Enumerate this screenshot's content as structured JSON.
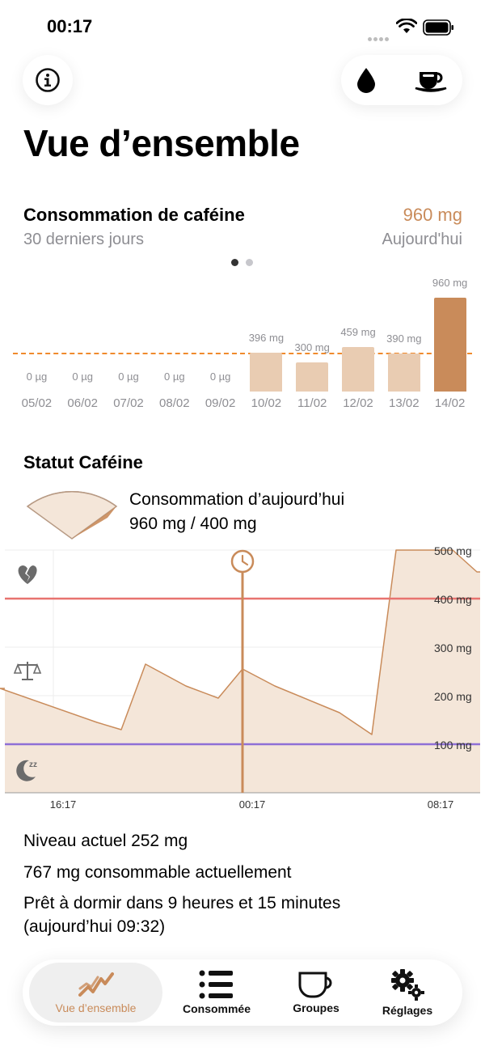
{
  "status_bar": {
    "time": "00:17"
  },
  "page_title": "Vue d’ensemble",
  "consumption": {
    "title": "Consommation de caféine",
    "subtitle": "30 derniers jours",
    "today_value": "960 mg",
    "today_label": "Aujourd'hui"
  },
  "chart_data": {
    "type": "bar",
    "categories": [
      "05/02",
      "06/02",
      "07/02",
      "08/02",
      "09/02",
      "10/02",
      "11/02",
      "12/02",
      "13/02",
      "14/02"
    ],
    "values": [
      0,
      0,
      0,
      0,
      0,
      396,
      300,
      459,
      390,
      960
    ],
    "value_labels": [
      "0 µg",
      "0 µg",
      "0 µg",
      "0 µg",
      "0 µg",
      "396 mg",
      "300 mg",
      "459 mg",
      "390 mg",
      "960 mg"
    ],
    "reference_line": 400,
    "ylim": [
      0,
      960
    ],
    "highlight_index": 9,
    "colors": {
      "bar": "#e9ccb2",
      "highlight": "#c98b5a",
      "reference": "#f08a2c"
    }
  },
  "status": {
    "title": "Statut Caféine",
    "today_label": "Consommation d’aujourd’hui",
    "today_value": "960 mg / 400 mg",
    "icons": [
      "broken-heart-icon",
      "scale-icon",
      "sleep-moon-icon",
      "clock-icon"
    ]
  },
  "level_chart": {
    "type": "area",
    "y_ticks": [
      "500 mg",
      "400 mg",
      "300 mg",
      "200 mg",
      "100 mg"
    ],
    "x_ticks": [
      "16:17",
      "00:17",
      "08:17"
    ],
    "ylim": [
      0,
      500
    ],
    "max_line": 400,
    "sleep_line": 100,
    "points": [
      [
        0,
        215
      ],
      [
        120,
        145
      ],
      [
        150,
        130
      ],
      [
        180,
        265
      ],
      [
        230,
        220
      ],
      [
        270,
        195
      ],
      [
        300,
        255
      ],
      [
        340,
        220
      ],
      [
        420,
        165
      ],
      [
        460,
        120
      ],
      [
        490,
        500
      ],
      [
        560,
        500
      ],
      [
        590,
        455
      ]
    ],
    "colors": {
      "fill": "#f4e6d9",
      "stroke": "#c98b5a",
      "max": "#e8736f",
      "sleep": "#8e6fd6",
      "now": "#c98b5a"
    }
  },
  "info": {
    "current_level": "Niveau actuel 252 mg",
    "consumable": "767 mg consommable actuellement",
    "sleep_ready": "Prêt à dormir dans 9 heures et 15 minutes",
    "sleep_time": "(aujourd’hui 09:32)"
  },
  "tabs": [
    {
      "label": "Vue d’ensemble",
      "icon": "trend-chart-icon",
      "active": true
    },
    {
      "label": "Consommée",
      "icon": "list-icon",
      "active": false
    },
    {
      "label": "Groupes",
      "icon": "cup-icon",
      "active": false
    },
    {
      "label": "Réglages",
      "icon": "gears-icon",
      "active": false
    }
  ]
}
